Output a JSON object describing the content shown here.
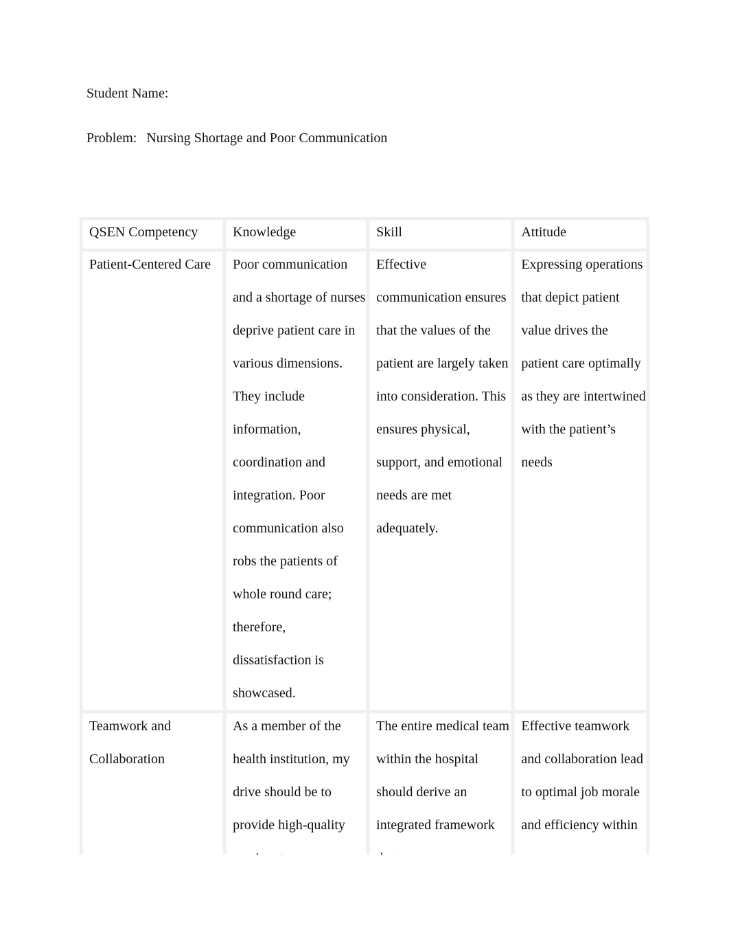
{
  "header": {
    "student_label": "Student Name:",
    "problem_label": "Problem:",
    "problem_value": "Nursing Shortage and Poor Communication"
  },
  "table": {
    "columns": [
      "QSEN Competency",
      "Knowledge",
      "Skill",
      "Attitude"
    ],
    "rows": [
      {
        "competency": "Patient-Centered Care",
        "knowledge": "Poor communication and a shortage of nurses deprive patient care in various dimensions. They include information, coordination and integration. Poor communication also robs the patients of whole round care; therefore, dissatisfaction is showcased.",
        "skill": "Effective communication ensures that the values of the patient are largely taken into consideration. This ensures physical, support, and emotional needs are met adequately.",
        "attitude": "Expressing operations that depict patient value drives the patient care optimally as they are intertwined with the patient’s needs"
      },
      {
        "competency": "Teamwork and Collaboration",
        "knowledge": "As a member of the health institution, my drive should be to provide high-quality services to my",
        "skill": "The entire medical team within the hospital should derive an integrated framework that",
        "attitude": "Effective teamwork and collaboration lead to optimal job morale and efficiency within"
      }
    ]
  }
}
